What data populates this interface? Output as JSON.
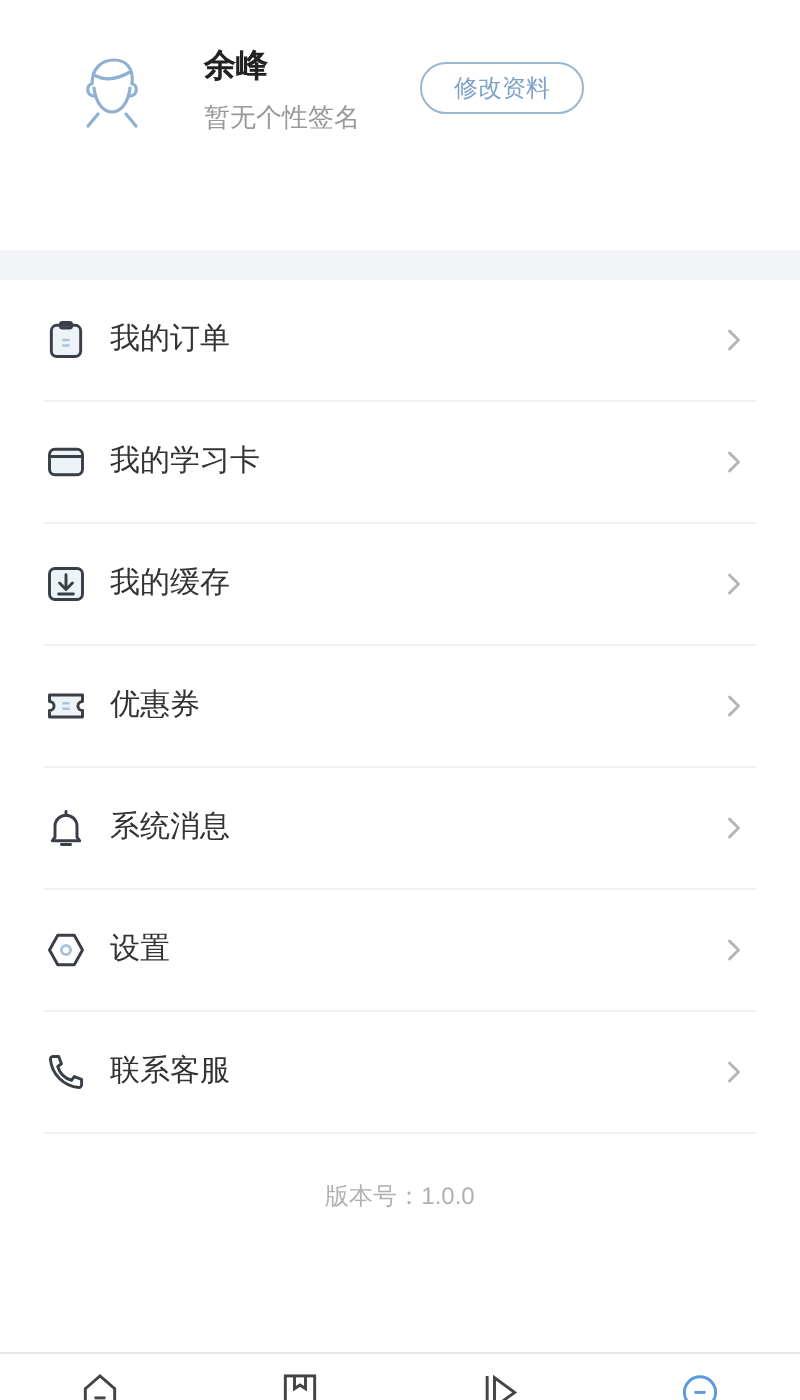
{
  "profile": {
    "name": "余峰",
    "signature": "暂无个性签名",
    "edit_button": "修改资料"
  },
  "menu": [
    {
      "label": "我的订单"
    },
    {
      "label": "我的学习卡"
    },
    {
      "label": "我的缓存"
    },
    {
      "label": "优惠券"
    },
    {
      "label": "系统消息"
    },
    {
      "label": "设置"
    },
    {
      "label": "联系客服"
    }
  ],
  "version": "版本号：1.0.0",
  "tab_bar": [
    {
      "selected": false
    },
    {
      "selected": false
    },
    {
      "selected": false
    },
    {
      "selected": true
    }
  ]
}
